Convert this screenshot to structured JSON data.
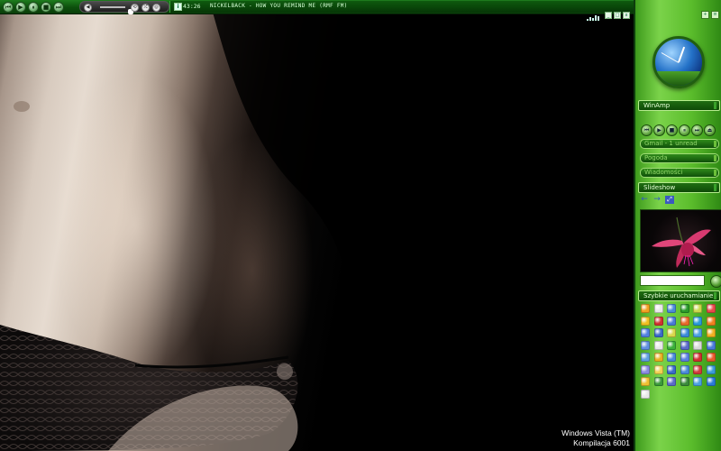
{
  "player": {
    "buttons": [
      {
        "name": "prev-button",
        "glyph": "⏮"
      },
      {
        "name": "play-button",
        "glyph": "▶"
      },
      {
        "name": "pause-button",
        "glyph": "⏸"
      },
      {
        "name": "stop-button",
        "glyph": "■"
      },
      {
        "name": "next-button",
        "glyph": "⏭"
      }
    ],
    "mute_glyph": "◀",
    "repeat_glyph": "⟲",
    "shuffle_glyph": "⤮",
    "eq_glyph": "◎",
    "volume_level": 0.4,
    "time": "43:26",
    "track_title": "NICKELBACK - HOW YOU REMIND ME (RMF FM)"
  },
  "desktop": {
    "os_name": "Windows Vista (TM)",
    "build": "Kompilacja 6001"
  },
  "sidebar": {
    "sections": {
      "winamp": "WinAmp",
      "slideshow": "Slideshow",
      "quick_launch": "Szybkie uruchamianie"
    },
    "winamp_bars": [
      "Gmail - 1 unread",
      "Pogoda",
      "Wiadomości"
    ],
    "media_buttons": [
      "⏮",
      "▶",
      "■",
      "⏸",
      "⏭",
      "⏏"
    ],
    "slideshow_nav": [
      "←",
      "→",
      "⤢"
    ],
    "search_placeholder": "",
    "colors": {
      "accent": "#5bbd2c",
      "title_bg": "#0f4a08",
      "title_text": "#e5ffd6",
      "player_bar": "#0c4f0c"
    }
  },
  "quick_launch_icons": [
    [
      "#f0a020",
      "#e8e8e8",
      "#4a8ad8",
      "#2a9a2a",
      "#c8d84a",
      "#e84a4a"
    ],
    [
      "#f0c020",
      "#d03030",
      "#4a7ad8",
      "#e86a2a",
      "#2a9ad8",
      "#f08020"
    ],
    [
      "#5080e0",
      "#3a6ac8",
      "#d8d84a",
      "#3a8ad8",
      "#4aa0e0",
      "#f0b020"
    ],
    [
      "#6090e0",
      "#e8e8e8",
      "#3ab03a",
      "#5a6ac8",
      "#d8d8d8",
      "#4a7ad8"
    ],
    [
      "#60a0e0",
      "#e8b020",
      "#4a8ad8",
      "#5a80e0",
      "#d03030",
      "#e85a2a"
    ],
    [
      "#8a8ae0",
      "#f0d050",
      "#3a6ac8",
      "#4a8ad8",
      "#d03a3a",
      "#3a9ad8"
    ],
    [
      "#f0c030",
      "#3a9a3a",
      "#5a6ac8",
      "#3a8a3a",
      "#4aa0e0",
      "#2a7ad8"
    ],
    [
      "#e8e8e8"
    ]
  ]
}
